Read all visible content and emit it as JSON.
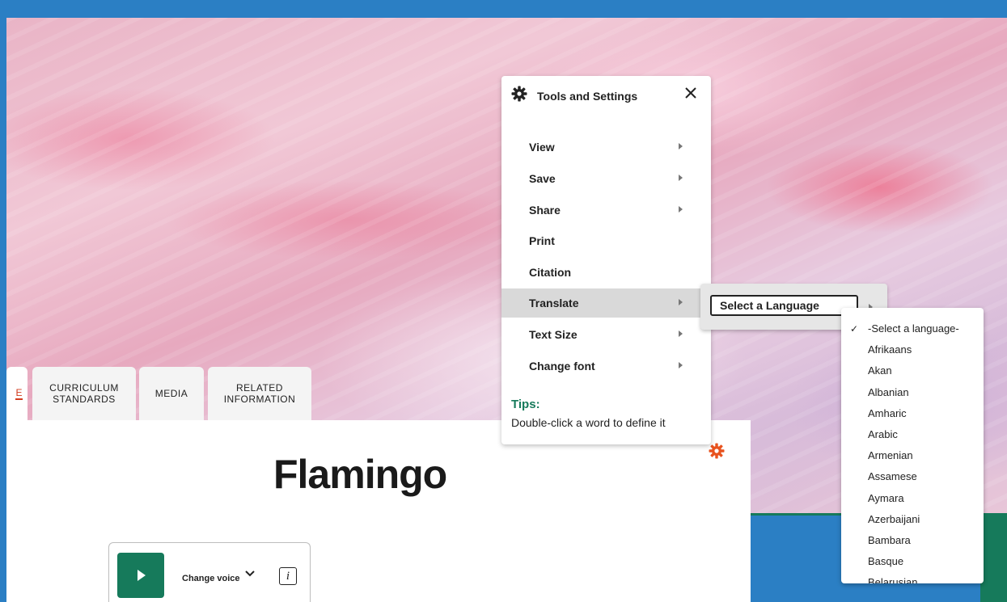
{
  "tabs": [
    {
      "label": "E"
    },
    {
      "label": "CURRICULUM\nSTANDARDS"
    },
    {
      "label": "MEDIA"
    },
    {
      "label": "RELATED\nINFORMATION"
    }
  ],
  "page": {
    "title": "Flamingo"
  },
  "player": {
    "change_voice_label": "Change voice",
    "info_label": "i"
  },
  "tools": {
    "title": "Tools and Settings",
    "menu": [
      {
        "label": "View",
        "has_submenu": true
      },
      {
        "label": "Save",
        "has_submenu": true
      },
      {
        "label": "Share",
        "has_submenu": true
      },
      {
        "label": "Print",
        "has_submenu": false
      },
      {
        "label": "Citation",
        "has_submenu": false
      },
      {
        "label": "Translate",
        "has_submenu": true,
        "active": true
      },
      {
        "label": "Text Size",
        "has_submenu": true
      },
      {
        "label": "Change font",
        "has_submenu": true
      }
    ],
    "tips_label": "Tips:",
    "tips_text": "Double-click a word to define it"
  },
  "translate": {
    "select_label": "Select a Language",
    "languages": [
      "-Select a language-",
      "Afrikaans",
      "Akan",
      "Albanian",
      "Amharic",
      "Arabic",
      "Armenian",
      "Assamese",
      "Aymara",
      "Azerbaijani",
      "Bambara",
      "Basque",
      "Belarusian"
    ],
    "selected_index": 0
  },
  "colors": {
    "accent_green": "#167a5b",
    "accent_orange": "#e8531f",
    "frame_blue": "#2b7fc4"
  }
}
